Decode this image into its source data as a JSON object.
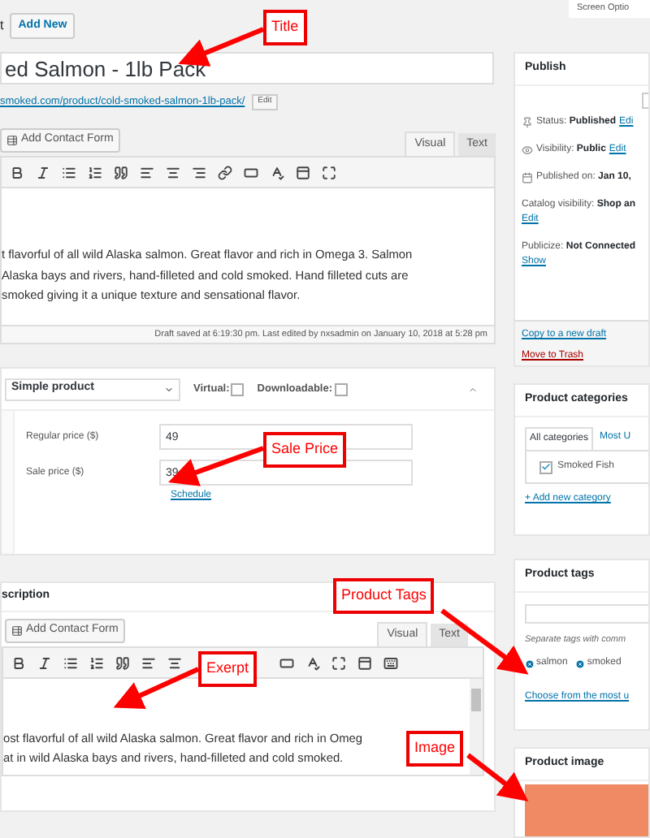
{
  "page_heading_fragment": "t",
  "add_new_button": "Add New",
  "screen_options": "Screen Optio",
  "title_field": {
    "value": "ed Salmon - 1lb Pack"
  },
  "permalink": {
    "url": "smoked.com/product/cold-smoked-salmon-1lb-pack/",
    "edit_button": "Edit"
  },
  "editor": {
    "add_contact_form": "Add Contact Form",
    "tabs": [
      {
        "label": "Visual",
        "selected": true
      },
      {
        "label": "Text",
        "selected": false
      }
    ],
    "content": "t flavorful of all wild Alaska salmon. Great flavor and rich in Omega 3. Salmon\nAlaska bays and rivers, hand-filleted and cold smoked. Hand filleted cuts are\nsmoked giving it a unique texture and sensational flavor.",
    "status": "Draft saved at 6:19:30 pm. Last edited by nxsadmin on January 10, 2018 at 5:28 pm"
  },
  "product_data": {
    "type_select": "Simple product",
    "options": [
      {
        "label": "Virtual:",
        "checked": false
      },
      {
        "label": "Downloadable:",
        "checked": false
      }
    ],
    "fields": [
      {
        "label": "Regular price ($)",
        "value": "49"
      },
      {
        "label": "Sale price ($)",
        "value": "39"
      }
    ],
    "schedule_link": "Schedule"
  },
  "short_description": {
    "heading": "scription",
    "add_contact_form": "Add Contact Form",
    "tabs": [
      {
        "label": "Visual",
        "selected": true
      },
      {
        "label": "Text",
        "selected": false
      }
    ],
    "content": "ost flavorful of all wild Alaska salmon. Great flavor and rich in Omeg\nat in wild Alaska bays and rivers, hand-filleted and cold smoked."
  },
  "publish": {
    "heading": "Publish",
    "rows": [
      {
        "kind": "status",
        "label": "Status:",
        "value": "Published",
        "link": "Edi"
      },
      {
        "kind": "visibility",
        "label": "Visibility:",
        "value": "Public",
        "link": "Edit"
      },
      {
        "kind": "date",
        "label": "Published on:",
        "value": "Jan 10,"
      },
      {
        "kind": "plain",
        "label": "Catalog visibility:",
        "value": "Shop an",
        "link": "Edit"
      },
      {
        "kind": "plain",
        "label": "Publicize:",
        "value": "Not Connected",
        "link": "Show"
      }
    ],
    "copy_link": "Copy to a new draft",
    "trash_link": "Move to Trash"
  },
  "product_categories": {
    "heading": "Product categories",
    "tabs": [
      {
        "label": "All categories",
        "selected": true
      },
      {
        "label": "Most U",
        "selected": false
      }
    ],
    "items": [
      {
        "label": "Smoked Fish",
        "checked": true
      }
    ],
    "add_link": "+ Add new category"
  },
  "product_tags": {
    "heading": "Product tags",
    "hint": "Separate tags with comm",
    "tags": [
      "salmon",
      "smoked"
    ],
    "choose_link": "Choose from the most u"
  },
  "product_image": {
    "heading": "Product image"
  },
  "annotations": [
    {
      "label": "Title"
    },
    {
      "label": "Sale Price"
    },
    {
      "label": "Product Tags"
    },
    {
      "label": "Exerpt"
    },
    {
      "label": "Image"
    }
  ]
}
